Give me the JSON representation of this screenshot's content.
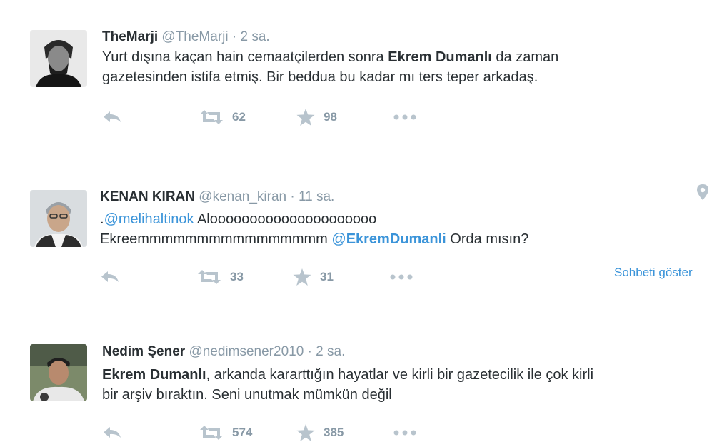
{
  "colors": {
    "text": "#292f33",
    "meta": "#8899a6",
    "link": "#3b94d9",
    "icon": "#b8c4cd"
  },
  "tweets": [
    {
      "name": "TheMarji",
      "handle": "@TheMarji",
      "sep": "·",
      "time": "2 sa.",
      "line1_a": "Yurt dışına kaçan hain cemaatçilerden sonra ",
      "line1_b": "Ekrem Dumanlı",
      "line1_c": " da zaman",
      "line2": "gazetesinden istifa etmiş. Bir beddua bu kadar mı ters teper arkadaş.",
      "retweets": "62",
      "likes": "98"
    },
    {
      "name": "KENAN KIRAN",
      "handle": "@kenan_kiran",
      "sep": "·",
      "time": "11 sa.",
      "line1_pre": ".",
      "mention1": "@melihaltinok",
      "line1_post": " Alooooooooooooooooooooo",
      "line2_pre": "Ekreemmmmmmmmmmmmmmmm ",
      "mention2_at": "@",
      "mention2_name": "EkremDumanli",
      "line2_post": " Orda mısın?",
      "retweets": "33",
      "likes": "31",
      "conversation": "Sohbeti göster"
    },
    {
      "name": "Nedim Şener",
      "handle": "@nedimsener2010",
      "sep": "·",
      "time": "2 sa.",
      "line1_a": "Ekrem Dumanlı",
      "line1_b": ", arkanda kararttığın hayatlar ve kirli bir gazetecilik ile çok kirli",
      "line2": "bir arşiv bıraktın. Seni unutmak mümkün değil",
      "retweets": "574",
      "likes": "385"
    }
  ]
}
